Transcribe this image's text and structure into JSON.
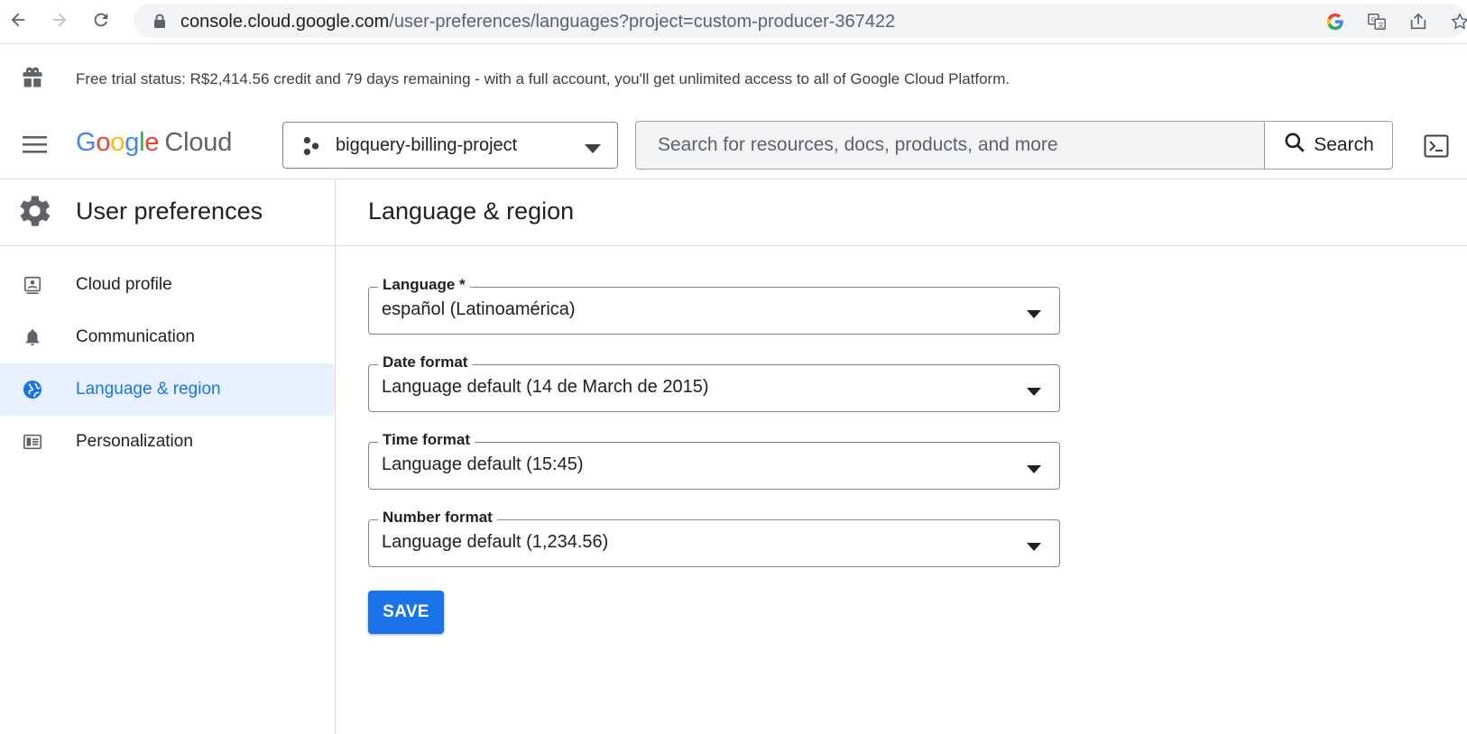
{
  "browser": {
    "url_host": "console.cloud.google.com",
    "url_path": "/user-preferences/languages?project=custom-producer-367422"
  },
  "trial_banner": {
    "text": "Free trial status: R$2,414.56 credit and 79 days remaining - with a full account, you'll get unlimited access to all of Google Cloud Platform."
  },
  "header": {
    "logo_google": "Google",
    "logo_cloud": "Cloud",
    "project_name": "bigquery-billing-project",
    "search_placeholder": "Search for resources, docs, products, and more",
    "search_button": "Search"
  },
  "sidebar": {
    "title": "User preferences",
    "items": [
      {
        "label": "Cloud profile",
        "icon": "profile-icon"
      },
      {
        "label": "Communication",
        "icon": "bell-icon"
      },
      {
        "label": "Language & region",
        "icon": "globe-icon",
        "active": true
      },
      {
        "label": "Personalization",
        "icon": "personalization-icon"
      }
    ]
  },
  "main": {
    "title": "Language & region",
    "fields": [
      {
        "label": "Language *",
        "value": "español (Latinoamérica)"
      },
      {
        "label": "Date format",
        "value": "Language default (14 de March de 2015)"
      },
      {
        "label": "Time format",
        "value": "Language default (15:45)"
      },
      {
        "label": "Number format",
        "value": "Language default (1,234.56)"
      }
    ],
    "save_label": "SAVE"
  },
  "colors": {
    "accent": "#1a73e8",
    "active_bg": "#e8f0fe",
    "text": "#202124",
    "secondary": "#5f6368"
  }
}
